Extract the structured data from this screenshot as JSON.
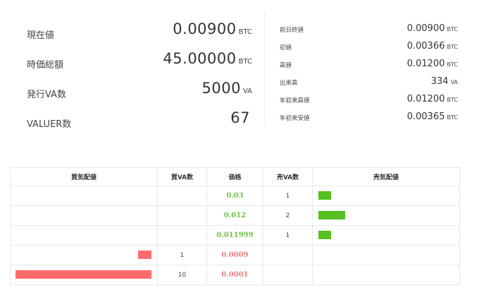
{
  "summary": {
    "left": [
      {
        "label": "現在値",
        "value": "0.00900",
        "unit": "BTC"
      },
      {
        "label": "時価総額",
        "value": "45.00000",
        "unit": "BTC"
      },
      {
        "label": "発行VA数",
        "value": "5000",
        "unit": "VA"
      },
      {
        "label": "VALUER数",
        "value": "67",
        "unit": ""
      }
    ],
    "right": [
      {
        "label": "前日終値",
        "value": "0.00900",
        "unit": "BTC"
      },
      {
        "label": "初値",
        "value": "0.00366",
        "unit": "BTC"
      },
      {
        "label": "高値",
        "value": "0.01200",
        "unit": "BTC"
      },
      {
        "label": "出来高",
        "value": "334",
        "unit": "VA"
      },
      {
        "label": "年初来高値",
        "value": "0.01200",
        "unit": "BTC"
      },
      {
        "label": "年初来安値",
        "value": "0.00365",
        "unit": "BTC"
      }
    ]
  },
  "order_book": {
    "headers": {
      "buy_depth": "買気配値",
      "buy_qty": "買VA数",
      "price": "価格",
      "sell_qty": "売VA数",
      "sell_depth": "売気配値"
    },
    "colors": {
      "sell_price": "#6cc644",
      "buy_price": "#f08080",
      "sell_bar": "#55c020",
      "buy_bar": "#ff6b6b"
    },
    "rows": [
      {
        "side": "sell",
        "price": "0.03",
        "qty": "1"
      },
      {
        "side": "sell",
        "price": "0.012",
        "qty": "2"
      },
      {
        "side": "sell",
        "price": "0.011999",
        "qty": "1"
      },
      {
        "side": "buy",
        "price": "0.0009",
        "qty": "1"
      },
      {
        "side": "buy",
        "price": "0.0001",
        "qty": "10"
      }
    ]
  }
}
